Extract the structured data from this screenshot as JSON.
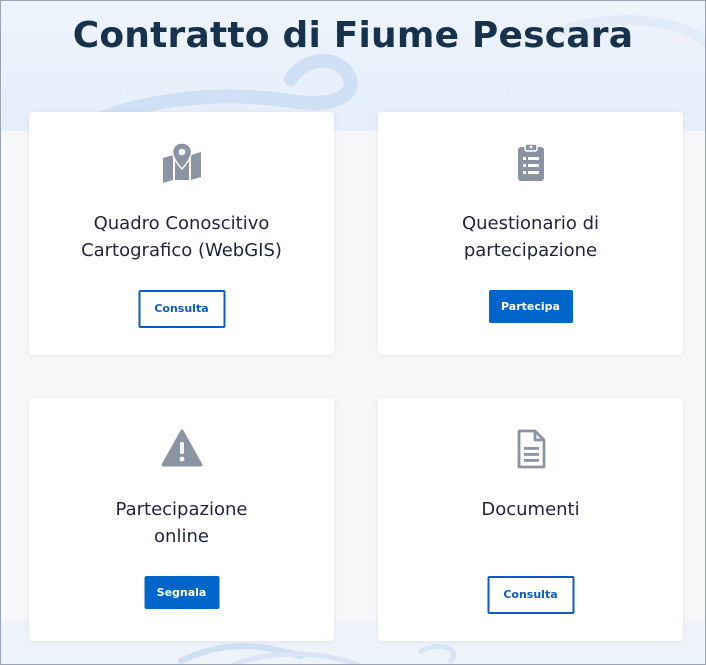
{
  "page": {
    "title": "Contratto di Fiume Pescara"
  },
  "cards": [
    {
      "icon": "map-marker-icon",
      "title_lines": [
        "Quadro Conoscitivo",
        "Cartografico (WebGIS)"
      ],
      "button_label": "Consulta",
      "button_style": "outline"
    },
    {
      "icon": "clipboard-list-icon",
      "title_lines": [
        "Questionario di",
        "partecipazione"
      ],
      "button_label": "Partecipa",
      "button_style": "filled"
    },
    {
      "icon": "warning-icon",
      "title_lines": [
        "Partecipazione",
        "online"
      ],
      "button_label": "Segnala",
      "button_style": "filled"
    },
    {
      "icon": "document-icon",
      "title_lines": [
        "Documenti"
      ],
      "button_label": "Consulta",
      "button_style": "outline"
    }
  ],
  "colors": {
    "primary": "#0066cc",
    "title": "#17324d",
    "icon": "#8a94a3",
    "hero_bg": "#e4eefa"
  }
}
